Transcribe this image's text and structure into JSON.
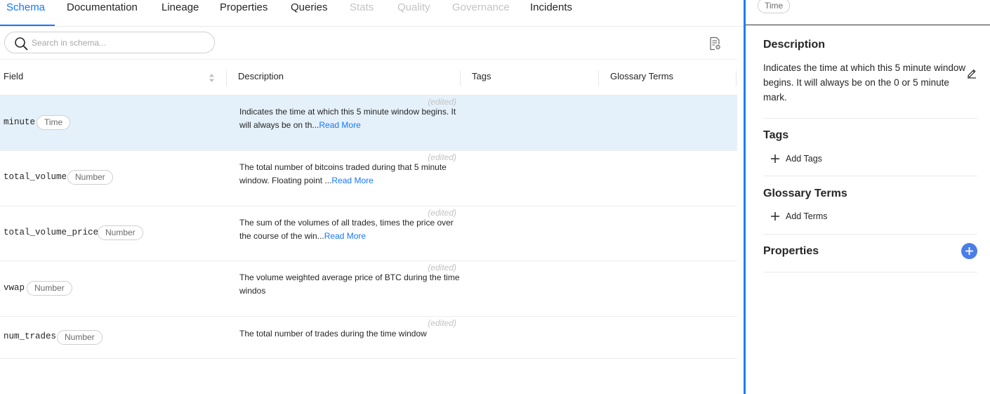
{
  "tabs": [
    {
      "label": "Schema",
      "state": "active"
    },
    {
      "label": "Documentation",
      "state": "normal"
    },
    {
      "label": "Lineage",
      "state": "normal"
    },
    {
      "label": "Properties",
      "state": "normal"
    },
    {
      "label": "Queries",
      "state": "normal"
    },
    {
      "label": "Stats",
      "state": "disabled"
    },
    {
      "label": "Quality",
      "state": "disabled"
    },
    {
      "label": "Governance",
      "state": "disabled"
    },
    {
      "label": "Incidents",
      "state": "normal"
    }
  ],
  "search": {
    "placeholder": "Search in schema...",
    "value": ""
  },
  "table": {
    "headers": {
      "field": "Field",
      "description": "Description",
      "tags": "Tags",
      "glossary": "Glossary Terms"
    },
    "read_more_label": "Read More",
    "edited_label": "(edited)",
    "rows": [
      {
        "field": "minute",
        "type": "Time",
        "description": "Indicates the time at which this 5 minute window begins. It will always be on th...",
        "read_more": true,
        "edited": true,
        "selected": true
      },
      {
        "field": "total_volume",
        "type": "Number",
        "description": "The total number of bitcoins traded during that 5 minute window. Floating point ...",
        "read_more": true,
        "edited": true,
        "selected": false
      },
      {
        "field": "total_volume_price",
        "type": "Number",
        "description": "The sum of the volumes of all trades, times the price over the course of the win...",
        "read_more": true,
        "edited": true,
        "selected": false
      },
      {
        "field": "vwap",
        "type": "Number",
        "description": "The volume weighted average price of BTC during the time windos",
        "read_more": false,
        "edited": true,
        "selected": false
      },
      {
        "field": "num_trades",
        "type": "Number",
        "description": "The total number of trades during the time window",
        "read_more": false,
        "edited": true,
        "selected": false
      }
    ]
  },
  "panel": {
    "type_badge": "Time",
    "description_title": "Description",
    "description_text": "Indicates the time at which this 5 minute window begins. It will always be on the 0 or 5 minute mark.",
    "tags_title": "Tags",
    "add_tags_label": "Add Tags",
    "glossary_title": "Glossary Terms",
    "add_terms_label": "Add Terms",
    "properties_title": "Properties"
  },
  "colors": {
    "accent": "#1677ff",
    "selected_row": "#e5f1fa",
    "divider": "#1c7ef2",
    "properties_button": "#4a7ee6"
  },
  "icons": {
    "search": "magnifier-icon",
    "columns": "document-settings-icon",
    "sort": "sort-arrows-icon",
    "edit": "pencil-icon",
    "add": "plus-icon"
  }
}
